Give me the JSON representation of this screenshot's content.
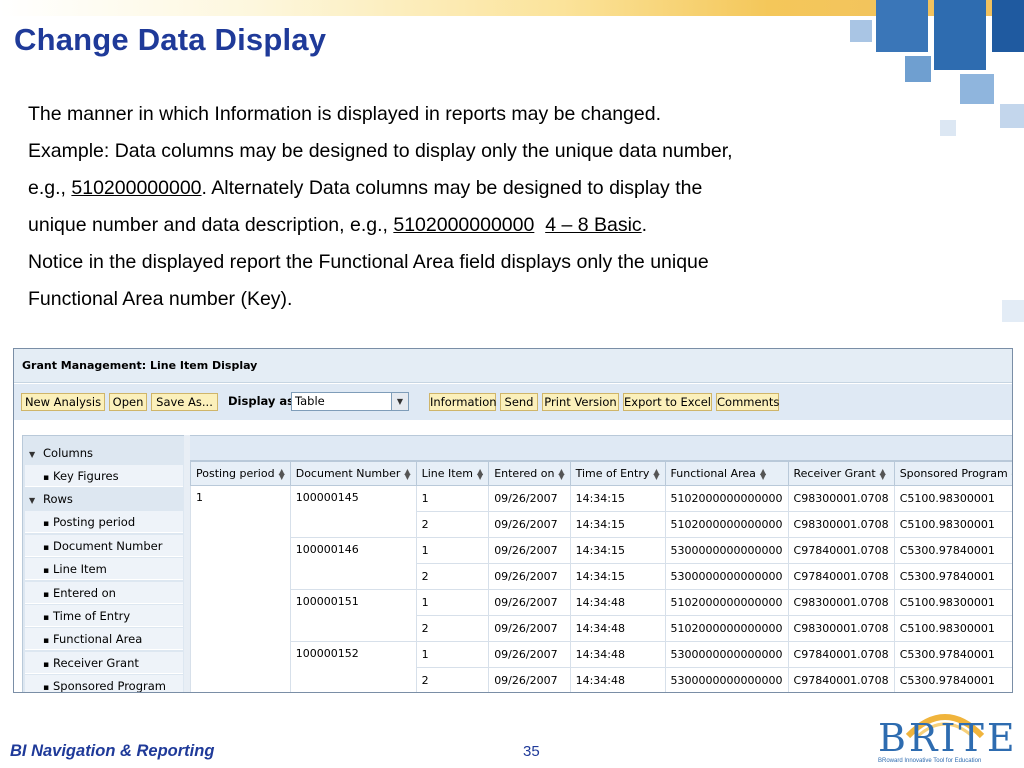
{
  "slide": {
    "title": "Change Data Display",
    "paragraphs": {
      "p1": "The manner in which Information is displayed in reports may be changed.",
      "p2a": "Example:  Data columns  may be designed to display only the unique data number,",
      "p2b": "e.g., ",
      "p2c": "510200000000",
      "p2d": ".  Alternately Data columns  may be designed to display the",
      "p2e": "unique number and data description, e.g., ",
      "p2f": "5102000000000",
      "p2g": "  ",
      "p2h": "4 – 8 Basic",
      "p2i": ".",
      "p3a": "Notice in the displayed report the Functional Area field displays only the unique",
      "p3b": "Functional Area number (Key)."
    },
    "footer": {
      "left": "BI Navigation & Reporting",
      "page": "35"
    },
    "logo": {
      "text": "BRITE",
      "subtitle": "BRoward Innovative Tool for Education"
    },
    "colors": {
      "title": "#1f3a99",
      "accent_gold": "#f0c060",
      "deco_blue": "#2e6cb0"
    }
  },
  "app": {
    "title": "Grant Management: Line Item Display",
    "toolbar": {
      "new_analysis": "New Analysis",
      "open": "Open",
      "save_as": "Save As...",
      "display_as_label": "Display as",
      "display_as_value": "Table",
      "information": "Information",
      "send": "Send",
      "print_version": "Print Version",
      "export_to_excel": "Export to Excel",
      "comments": "Comments"
    },
    "nav": {
      "columns": "Columns",
      "key_figures": "Key Figures",
      "rows": "Rows",
      "row_items": [
        "Posting period",
        "Document Number",
        "Line Item",
        "Entered on",
        "Time of Entry",
        "Functional Area",
        "Receiver Grant",
        "Sponsored Program"
      ]
    },
    "grid": {
      "headers": [
        "Posting period",
        "Document Number",
        "Line Item",
        "Entered on",
        "Time of Entry",
        "Functional Area",
        "Receiver Grant",
        "Sponsored Program"
      ],
      "posting_period": "1",
      "documents": [
        {
          "number": "100000145",
          "rows": [
            [
              "1",
              "09/26/2007",
              "14:34:15",
              "5102000000000000",
              "C98300001.0708",
              "C5100.98300001"
            ],
            [
              "2",
              "09/26/2007",
              "14:34:15",
              "5102000000000000",
              "C98300001.0708",
              "C5100.98300001"
            ]
          ]
        },
        {
          "number": "100000146",
          "rows": [
            [
              "1",
              "09/26/2007",
              "14:34:15",
              "5300000000000000",
              "C97840001.0708",
              "C5300.97840001"
            ],
            [
              "2",
              "09/26/2007",
              "14:34:15",
              "5300000000000000",
              "C97840001.0708",
              "C5300.97840001"
            ]
          ]
        },
        {
          "number": "100000151",
          "rows": [
            [
              "1",
              "09/26/2007",
              "14:34:48",
              "5102000000000000",
              "C98300001.0708",
              "C5100.98300001"
            ],
            [
              "2",
              "09/26/2007",
              "14:34:48",
              "5102000000000000",
              "C98300001.0708",
              "C5100.98300001"
            ]
          ]
        },
        {
          "number": "100000152",
          "rows": [
            [
              "1",
              "09/26/2007",
              "14:34:48",
              "5300000000000000",
              "C97840001.0708",
              "C5300.97840001"
            ],
            [
              "2",
              "09/26/2007",
              "14:34:48",
              "5300000000000000",
              "C97840001.0708",
              "C5300.97840001"
            ]
          ]
        }
      ]
    }
  }
}
